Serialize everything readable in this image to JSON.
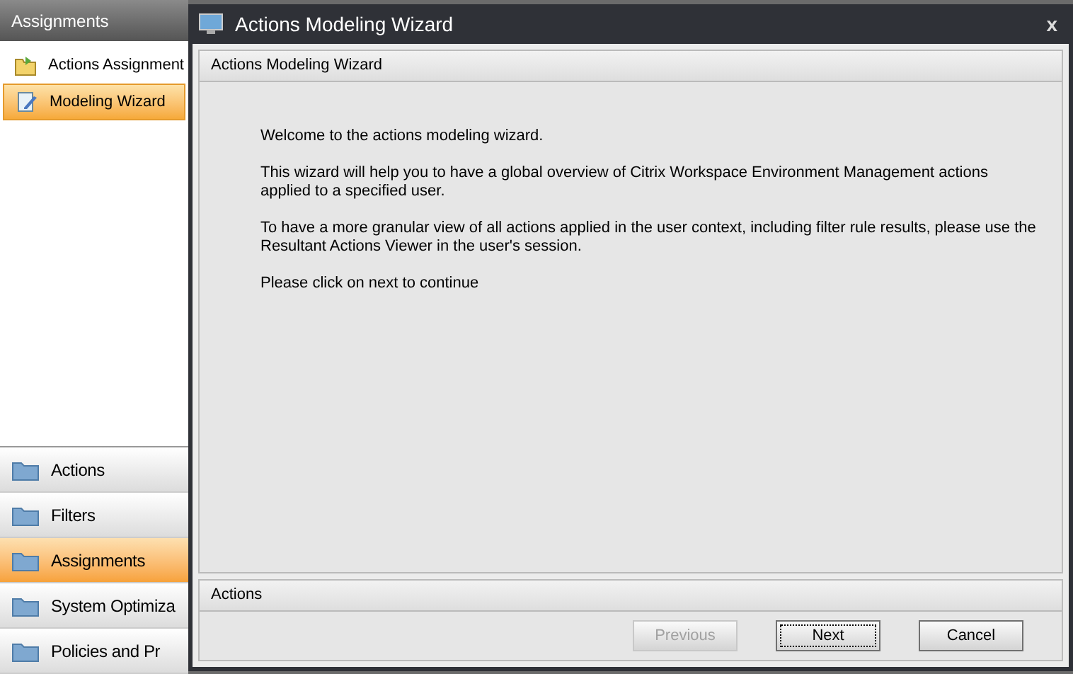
{
  "sidebar": {
    "header": "Assignments",
    "items": [
      {
        "label": "Actions Assignment",
        "selected": false
      },
      {
        "label": "Modeling Wizard",
        "selected": true
      }
    ],
    "nav": [
      {
        "label": "Actions",
        "selected": false
      },
      {
        "label": "Filters",
        "selected": false
      },
      {
        "label": "Assignments",
        "selected": true
      },
      {
        "label": "System Optimiza",
        "selected": false
      },
      {
        "label": "Policies and Pr",
        "selected": false
      }
    ]
  },
  "dialog": {
    "title": "Actions Modeling Wizard",
    "close": "x",
    "panel_title": "Actions Modeling Wizard",
    "paragraphs": [
      "Welcome to the actions modeling wizard.",
      "This wizard will help you to have a global overview of Citrix Workspace Environment Management actions applied to a specified user.",
      "To have a more granular view of all actions applied in the user context, including filter rule results, please use the Resultant Actions Viewer in the user's session.",
      "Please click on next to continue"
    ],
    "actions_title": "Actions",
    "buttons": [
      {
        "label": "Previous",
        "disabled": true,
        "focused": false
      },
      {
        "label": "Next",
        "disabled": false,
        "focused": true
      },
      {
        "label": "Cancel",
        "disabled": false,
        "focused": false
      }
    ]
  }
}
